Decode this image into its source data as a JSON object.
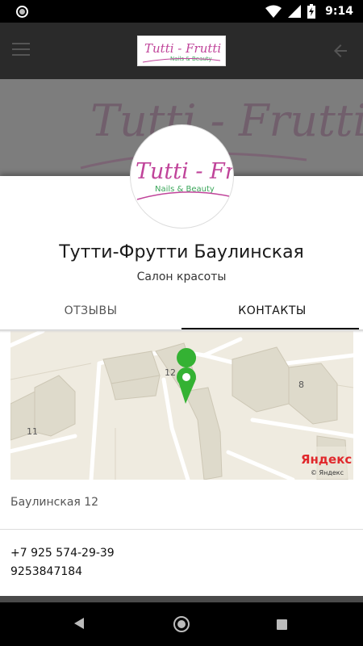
{
  "status_bar": {
    "time": "9:14",
    "icons": [
      "app-notification-icon",
      "wifi-icon",
      "signal-icon",
      "battery-charging-icon"
    ]
  },
  "app_bar": {
    "menu_icon": "hamburger-menu-icon",
    "back_icon": "arrow-back-icon",
    "logo": {
      "line1": "Tutti - Frutti",
      "line2": "Nails & Beauty"
    }
  },
  "cover": {
    "text": "Tutti - Frutti"
  },
  "profile": {
    "logo_line1": "Tutti - Frutti",
    "logo_line2": "Nails & Beauty",
    "name": "Тутти-Фрутти Баулинская",
    "type": "Салон красоты"
  },
  "tabs": [
    {
      "label": "ОТЗЫВЫ",
      "active": false
    },
    {
      "label": "КОНТАКТЫ",
      "active": true
    }
  ],
  "map": {
    "labels": {
      "building_12": "12",
      "building_8": "8",
      "building_11": "11"
    },
    "provider_logo": "Яндекс",
    "copyright": "© Яндекс"
  },
  "contacts": {
    "address": "Баулинская 12",
    "phones": [
      "+7 925 574-29-39",
      "9253847184"
    ]
  },
  "colors": {
    "brand_pink": "#c0449a",
    "brand_green": "#3aa65a",
    "map_marker": "#34b233",
    "app_bar": "#2a2a2a"
  }
}
